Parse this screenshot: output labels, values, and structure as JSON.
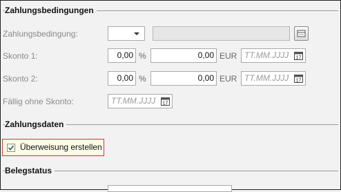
{
  "sections": {
    "zahlungsbedingungen": "Zahlungsbedingungen",
    "zahlungsdaten": "Zahlungsdaten",
    "belegstatus": "Belegstatus"
  },
  "fields": {
    "zahlungsbedingung_label": "Zahlungsbedingung:",
    "zahlungsbedingung_value": "",
    "skonto1_label": "Skonto 1:",
    "skonto1_percent": "0,00",
    "skonto1_amount": "0,00",
    "skonto2_label": "Skonto 2:",
    "skonto2_percent": "0,00",
    "skonto2_amount": "0,00",
    "faellig_label": "Fällig ohne Skonto:",
    "percent_unit": "%",
    "currency_unit": "EUR",
    "date_placeholder": "TT.MM.JJJJ",
    "calendar_day": "17"
  },
  "checkbox": {
    "label": "Überweisung erstellen",
    "checked": true
  },
  "colors": {
    "highlight_border": "#c43a3a",
    "highlight_bg": "#fbfbe6",
    "check_green": "#2e7d32"
  }
}
